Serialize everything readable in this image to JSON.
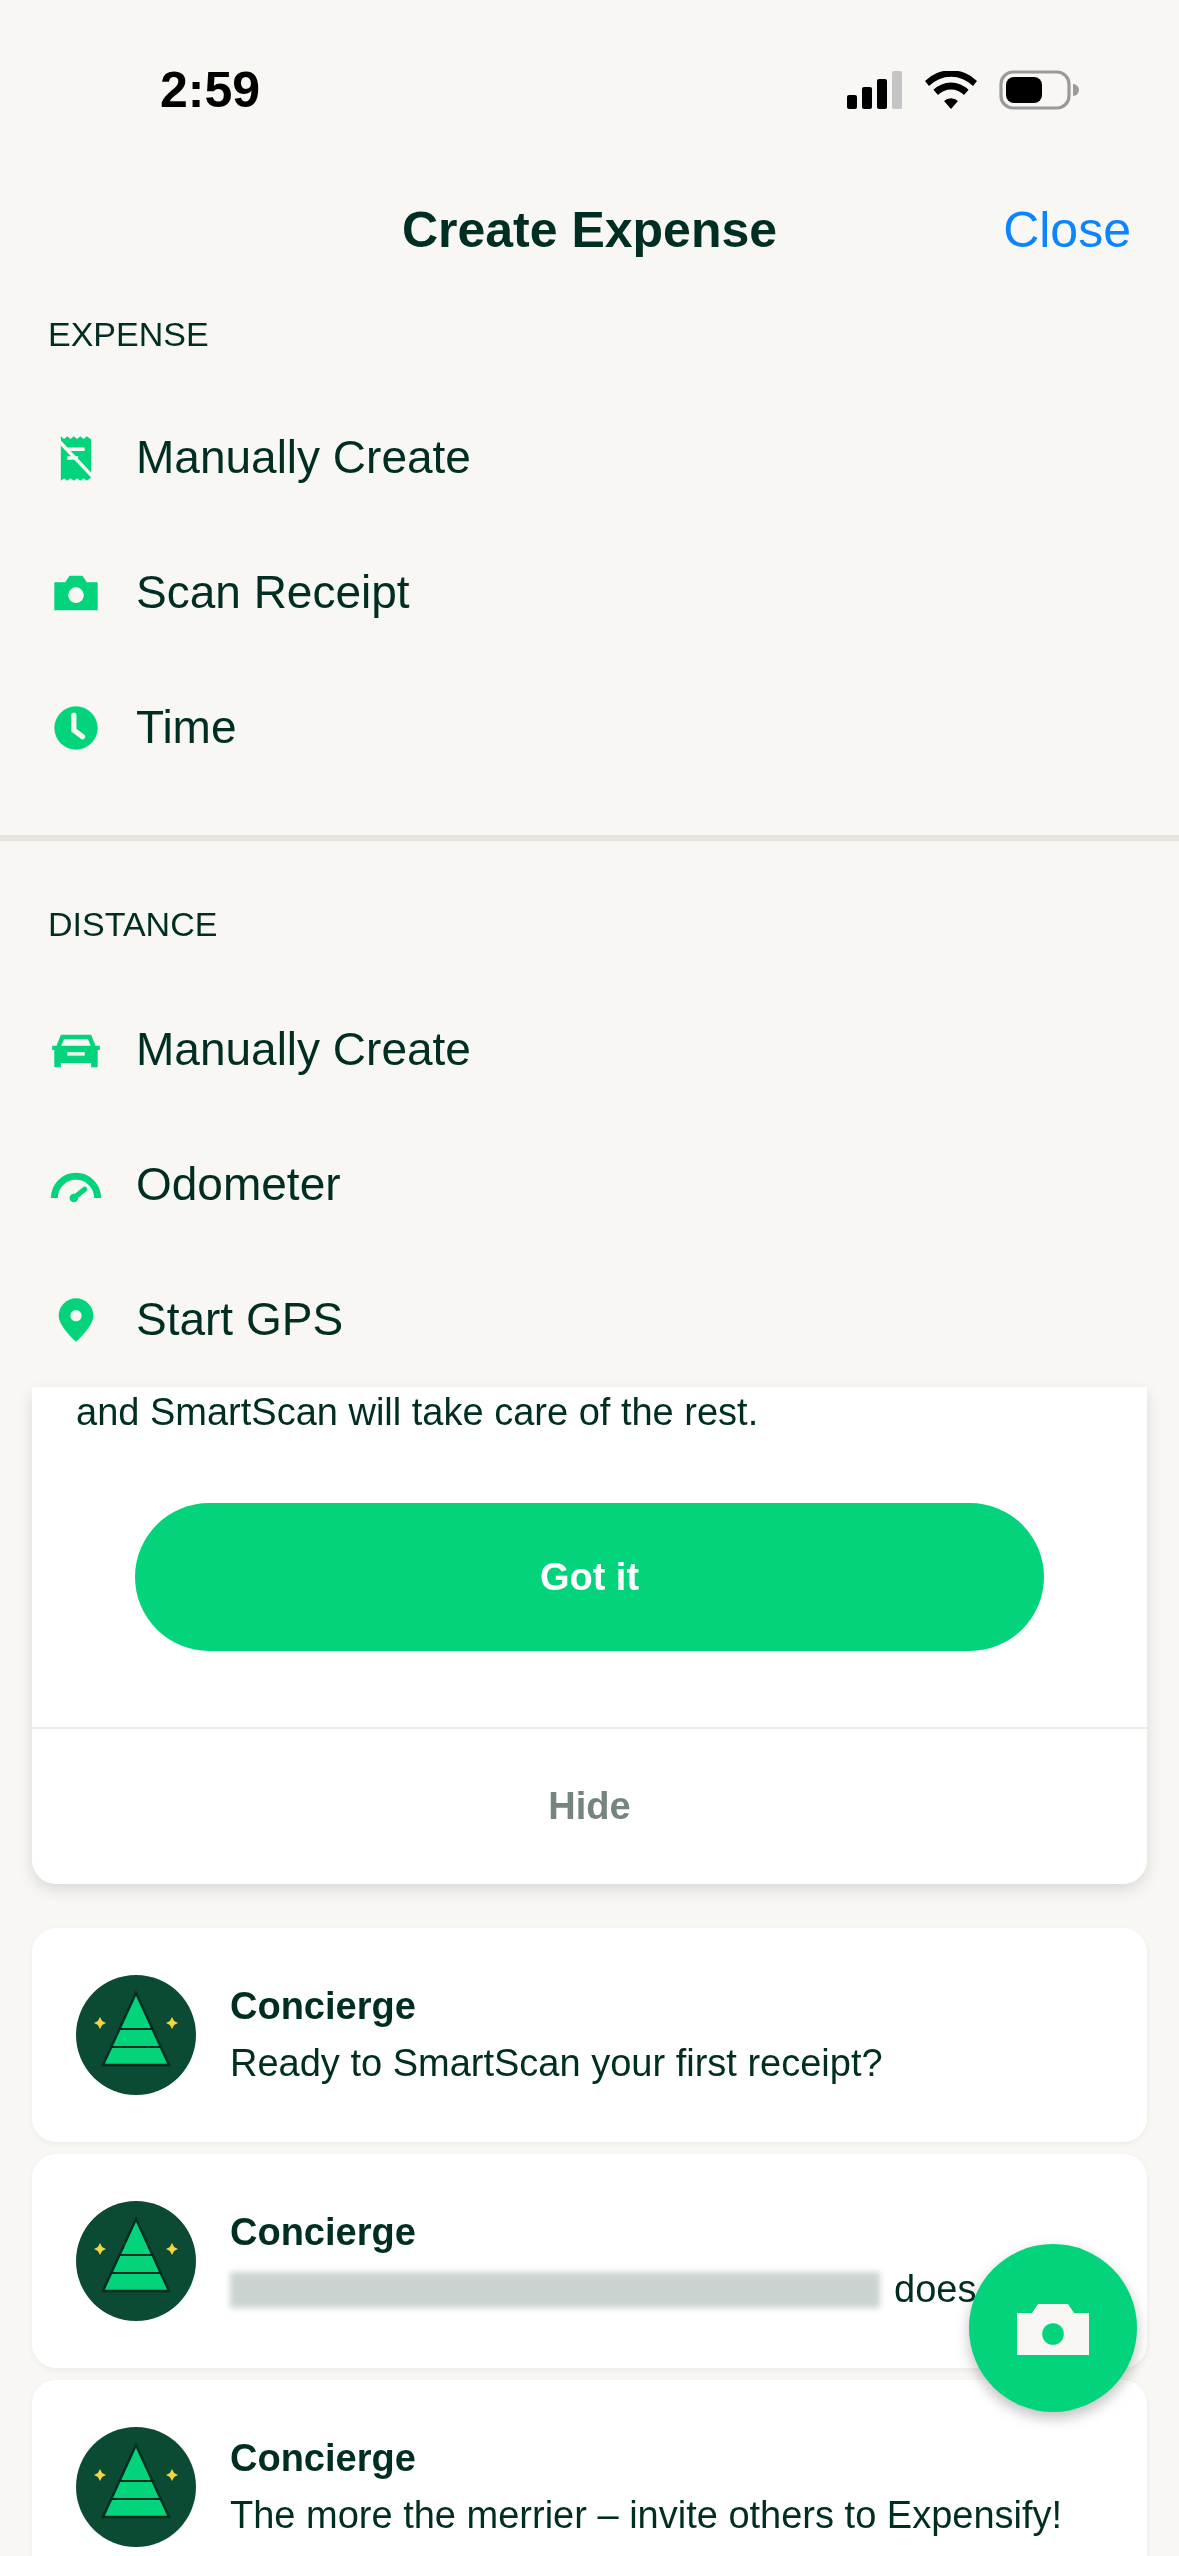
{
  "status_bar": {
    "time": "2:59"
  },
  "sheet": {
    "title": "Create Expense",
    "close": "Close",
    "sections": [
      {
        "heading": "EXPENSE",
        "items": [
          {
            "label": "Manually Create",
            "kind": "receipt"
          },
          {
            "label": "Scan Receipt",
            "kind": "camera"
          },
          {
            "label": "Time",
            "kind": "clock"
          }
        ]
      },
      {
        "heading": "DISTANCE",
        "items": [
          {
            "label": "Manually Create",
            "kind": "car"
          },
          {
            "label": "Odometer",
            "kind": "gauge"
          },
          {
            "label": "Start GPS",
            "kind": "pin"
          }
        ]
      }
    ]
  },
  "tip_card": {
    "text": "and SmartScan will take care of the rest.",
    "primary_button": "Got it",
    "secondary_button": "Hide"
  },
  "messages": [
    {
      "sender": "Concierge",
      "text": "Ready to SmartScan your first receipt?",
      "redacted": false
    },
    {
      "sender": "Concierge",
      "text": "does",
      "redacted": true
    },
    {
      "sender": "Concierge",
      "text": "The more the merrier – invite others to Expensify!",
      "redacted": false
    }
  ]
}
